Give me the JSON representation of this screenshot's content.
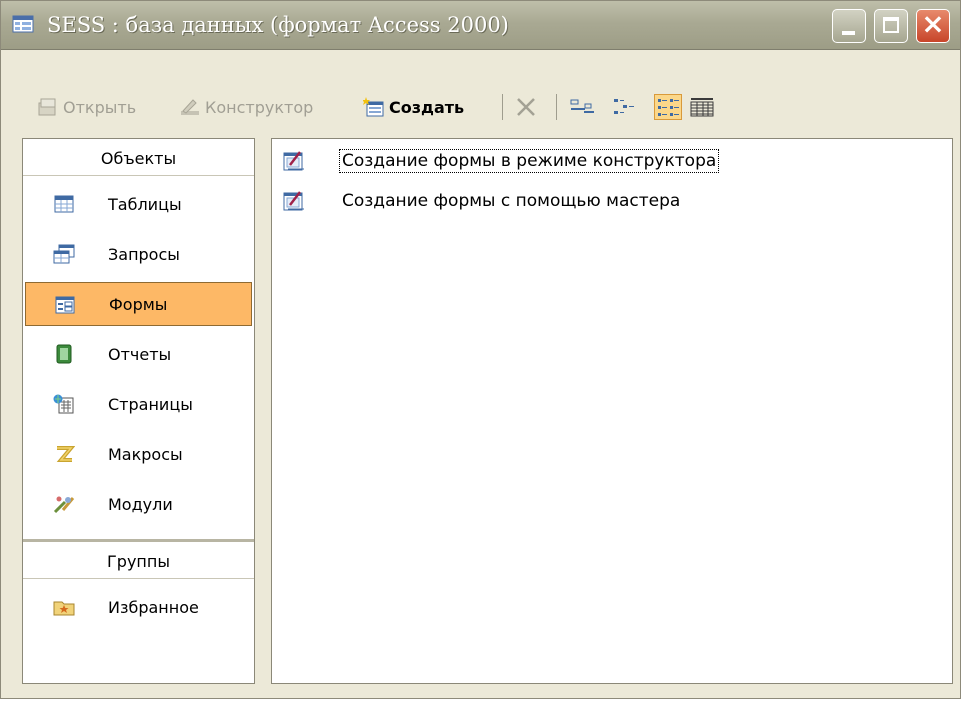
{
  "window": {
    "title": "SESS : база данных (формат Access 2000)",
    "icon": "database-window-icon",
    "controls": {
      "minimize": "minimize",
      "maximize": "maximize",
      "close": "close"
    }
  },
  "toolbar": {
    "open_label": "Открыть",
    "design_label": "Конструктор",
    "create_label": "Создать",
    "delete_icon": "delete-x-icon",
    "views": [
      "large-icons-view",
      "small-icons-view",
      "list-view",
      "details-view"
    ],
    "selected_view": "list-view"
  },
  "objects": {
    "header": "Объекты",
    "items": [
      {
        "label": "Таблицы",
        "icon": "table-icon"
      },
      {
        "label": "Запросы",
        "icon": "query-icon"
      },
      {
        "label": "Формы",
        "icon": "form-icon"
      },
      {
        "label": "Отчеты",
        "icon": "report-icon"
      },
      {
        "label": "Страницы",
        "icon": "page-icon"
      },
      {
        "label": "Макросы",
        "icon": "macro-icon"
      },
      {
        "label": "Модули",
        "icon": "module-icon"
      }
    ],
    "selected": "Формы"
  },
  "groups": {
    "header": "Группы",
    "items": [
      {
        "label": "Избранное",
        "icon": "favorites-icon"
      }
    ]
  },
  "list": {
    "items": [
      {
        "label": "Создание формы в режиме конструктора",
        "icon": "form-wizard-icon"
      },
      {
        "label": "Создание формы с помощью мастера",
        "icon": "form-wizard-icon"
      }
    ]
  },
  "colors": {
    "selected_bg": "#fdb866",
    "titlebar": "#a9a993",
    "toolbar_bg": "#ece9d8",
    "close_button": "#c8452a"
  }
}
